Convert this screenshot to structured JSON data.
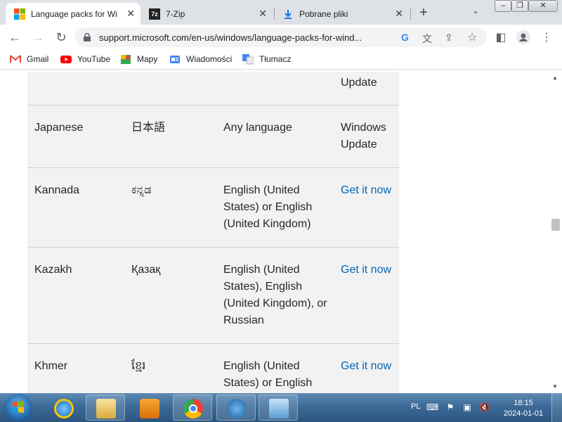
{
  "browser": {
    "tabs": [
      {
        "title": "Language packs for Wi",
        "icon": "windows-logo-icon",
        "active": true
      },
      {
        "title": "7-Zip",
        "icon": "7zip-icon",
        "active": false
      },
      {
        "title": "Pobrane pliki",
        "icon": "download-icon",
        "active": false
      }
    ],
    "tab_close_glyph": "✕",
    "new_tab_glyph": "+",
    "tab_search_glyph": "⌄",
    "window_controls": {
      "minimize": "–",
      "maximize": "❐",
      "close": "✕"
    },
    "nav": {
      "back": "←",
      "forward": "→",
      "reload": "↻"
    },
    "url": "support.microsoft.com/en-us/windows/language-packs-for-wind...",
    "omnibox_icons": {
      "google": "G",
      "translate": "文",
      "share": "⇪",
      "bookmark": "☆"
    },
    "toolbar_icons": {
      "sidepanel": "◧",
      "profile": "●",
      "menu": "⋮"
    },
    "bookmarks": [
      {
        "label": "Gmail",
        "icon": "gmail-icon"
      },
      {
        "label": "YouTube",
        "icon": "youtube-icon"
      },
      {
        "label": "Mapy",
        "icon": "maps-icon"
      },
      {
        "label": "Wiadomości",
        "icon": "news-icon"
      },
      {
        "label": "Tłumacz",
        "icon": "translate-icon"
      }
    ]
  },
  "table": {
    "rows": [
      {
        "language": "",
        "native": "",
        "requires": "",
        "get": "Update",
        "get_is_link": false
      },
      {
        "language": "Japanese",
        "native": "日本語",
        "requires": "Any language",
        "get": "Windows Update",
        "get_is_link": false
      },
      {
        "language": "Kannada",
        "native": "ಕನ್ನಡ",
        "requires": "English (United States) or English (United Kingdom)",
        "get": "Get it now",
        "get_is_link": true
      },
      {
        "language": "Kazakh",
        "native": "Қазақ",
        "requires": "English (United States), English (United Kingdom), or Russian",
        "get": "Get it now",
        "get_is_link": true
      },
      {
        "language": "Khmer",
        "native": "ខ្មែរ",
        "requires": "English (United States) or English",
        "get": "Get it now",
        "get_is_link": true
      }
    ]
  },
  "scrollbar": {
    "up": "▲",
    "down": "▼"
  },
  "taskbar": {
    "apps": [
      "internet-explorer",
      "file-explorer",
      "media-player",
      "chrome",
      "windows-media",
      "control-panel"
    ],
    "language": "PL",
    "time": "18:15",
    "date": "2024-01-01",
    "colors": {
      "accent": "#0067b8",
      "taskbar": "#3d6a97"
    }
  }
}
